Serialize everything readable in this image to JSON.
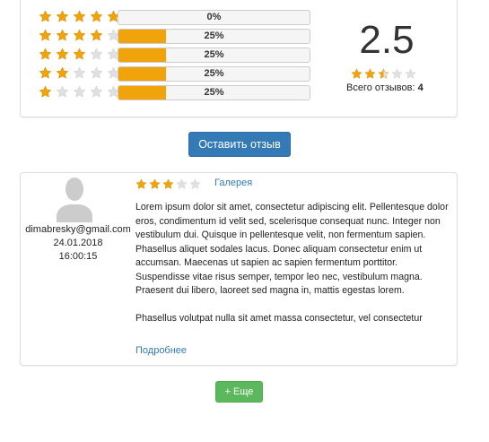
{
  "colors": {
    "star_filled": "#f0a30a",
    "star_empty": "#e0e0e0",
    "bar_fill": "#f0a30a",
    "primary": "#337ab7",
    "success": "#5cb85c"
  },
  "summary": {
    "distribution": [
      {
        "stars": 5,
        "percent_label": "0%",
        "fraction": 0.0
      },
      {
        "stars": 4,
        "percent_label": "25%",
        "fraction": 0.25
      },
      {
        "stars": 3,
        "percent_label": "25%",
        "fraction": 0.25
      },
      {
        "stars": 2,
        "percent_label": "25%",
        "fraction": 0.25
      },
      {
        "stars": 1,
        "percent_label": "25%",
        "fraction": 0.25
      }
    ],
    "average": "2.5",
    "average_rating": 2.5,
    "total_label": "Всего отзывов:",
    "total_count": "4"
  },
  "actions": {
    "leave_review_label": "Оставить отзыв",
    "more_label": "+ Еще"
  },
  "review": {
    "author": "dimabresky@gmail.com",
    "date": "24.01.2018",
    "time": "16:00:15",
    "rating": 3,
    "gallery_label": "Галерея",
    "text_p1": "Lorem ipsum dolor sit amet, consectetur adipiscing elit. Pellentesque dolor eros, condimentum id velit sed, scelerisque consequat nunc. Integer non vestibulum dui. Quisque in pellentesque velit, non fermentum sapien. Phasellus aliquet sodales lacus. Donec aliquam consectetur enim ut accumsan. Maecenas ut sapien ac sapien fermentum porttitor. Suspendisse vitae risus semper, tempor leo nec, vestibulum magna. Praesent dui libero, laoreet sed magna in, mattis egestas lorem.",
    "text_p2": "Phasellus volutpat nulla sit amet massa consectetur, vel consectetur",
    "more_link_label": "Подробнее",
    "icons": {
      "avatar": "user-silhouette-icon"
    }
  }
}
